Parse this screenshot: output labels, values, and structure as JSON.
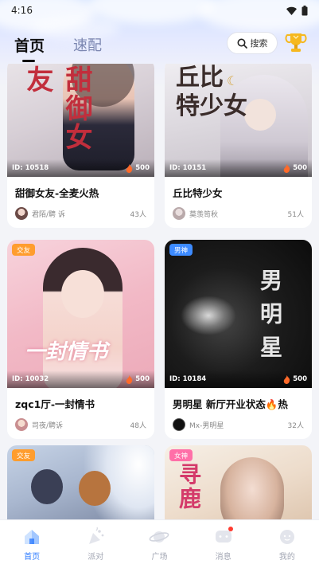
{
  "status_bar": {
    "time": "4:16"
  },
  "header": {
    "tabs": [
      {
        "label": "首页",
        "active": true
      },
      {
        "label": "速配",
        "active": false
      }
    ],
    "search_label": "搜索"
  },
  "rooms": [
    {
      "title": "甜御女友-全麦火热",
      "id_text": "ID: 10518",
      "heat": "500",
      "owner": "君陌/聘 诉",
      "count": "43人",
      "badge": "",
      "cover_text": "甜御女友"
    },
    {
      "title": "丘比特少女",
      "id_text": "ID: 10151",
      "heat": "500",
      "owner": "莫羡笥秋",
      "count": "51人",
      "badge": "",
      "cover_text": "丘比特少女"
    },
    {
      "title": "zqc1厅-一封情书",
      "id_text": "ID: 10032",
      "heat": "500",
      "owner": "司夜/聘诉",
      "count": "48人",
      "badge": "交友",
      "cover_text": "一封情书"
    },
    {
      "title": "男明星  新厅开业状态🔥热",
      "id_text": "ID: 10184",
      "heat": "500",
      "owner": "Mx-男明星",
      "count": "32人",
      "badge": "男神",
      "cover_text": "男明星"
    },
    {
      "title": "",
      "id_text": "",
      "heat": "",
      "owner": "",
      "count": "",
      "badge": "交友",
      "cover_text": ""
    },
    {
      "title": "",
      "id_text": "",
      "heat": "",
      "owner": "",
      "count": "",
      "badge": "女神",
      "cover_text": "寻鹿"
    }
  ],
  "tabbar": {
    "items": [
      {
        "label": "首页",
        "icon": "home-icon",
        "active": true
      },
      {
        "label": "派对",
        "icon": "party-icon",
        "active": false
      },
      {
        "label": "广场",
        "icon": "planet-icon",
        "active": false
      },
      {
        "label": "消息",
        "icon": "message-icon",
        "active": false,
        "unread": true
      },
      {
        "label": "我的",
        "icon": "profile-icon",
        "active": false
      }
    ]
  },
  "colors": {
    "accent": "#2f7cff",
    "badge_social": "#ff9d2e",
    "badge_male": "#3d8bff",
    "badge_female": "#ff6fa8",
    "heat": "#ff6a2a"
  }
}
